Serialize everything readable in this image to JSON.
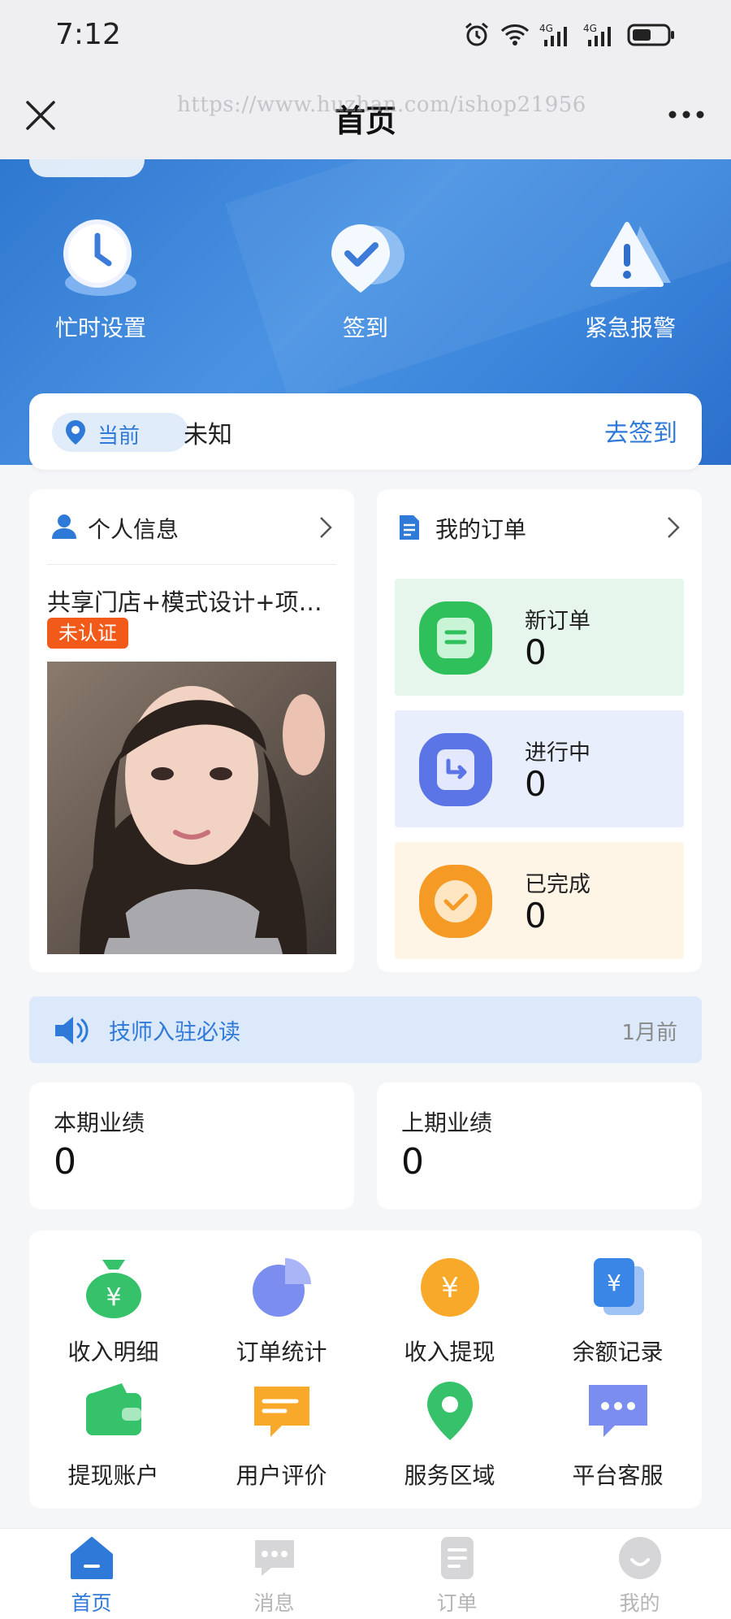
{
  "status_bar": {
    "time": "7:12"
  },
  "nav": {
    "title": "首页",
    "watermark": "https://www.huzhan.com/ishop21956"
  },
  "hero": {
    "actions": [
      {
        "label": "忙时设置",
        "icon": "clock-icon"
      },
      {
        "label": "签到",
        "icon": "check-pin-icon"
      },
      {
        "label": "紧急报警",
        "icon": "warning-icon"
      }
    ]
  },
  "location": {
    "chip_label": "当前",
    "value": "未知",
    "action": "去签到"
  },
  "profile_card": {
    "title": "个人信息",
    "name": "共享门店+模式设计+项…",
    "badge": "未认证"
  },
  "orders_card": {
    "title": "我的订单",
    "items": [
      {
        "label": "新订单",
        "value": "0"
      },
      {
        "label": "进行中",
        "value": "0"
      },
      {
        "label": "已完成",
        "value": "0"
      }
    ]
  },
  "notice": {
    "text": "技师入驻必读",
    "time": "1月前"
  },
  "performance": {
    "current_label": "本期业绩",
    "current_value": "0",
    "previous_label": "上期业绩",
    "previous_value": "0"
  },
  "grid": [
    {
      "label": "收入明细",
      "icon": "money-bag-icon"
    },
    {
      "label": "订单统计",
      "icon": "pie-chart-icon"
    },
    {
      "label": "收入提现",
      "icon": "yen-coin-icon"
    },
    {
      "label": "余额记录",
      "icon": "yen-card-icon"
    },
    {
      "label": "提现账户",
      "icon": "wallet-icon"
    },
    {
      "label": "用户评价",
      "icon": "comment-icon"
    },
    {
      "label": "服务区域",
      "icon": "location-icon"
    },
    {
      "label": "平台客服",
      "icon": "chat-icon"
    }
  ],
  "tabs": [
    {
      "label": "首页",
      "icon": "home-icon",
      "active": true
    },
    {
      "label": "消息",
      "icon": "message-icon",
      "active": false
    },
    {
      "label": "订单",
      "icon": "order-icon",
      "active": false
    },
    {
      "label": "我的",
      "icon": "profile-icon",
      "active": false
    }
  ],
  "colors": {
    "accent": "#2f7ad8",
    "badge": "#f25a1a",
    "hero": "#3b86dc"
  }
}
